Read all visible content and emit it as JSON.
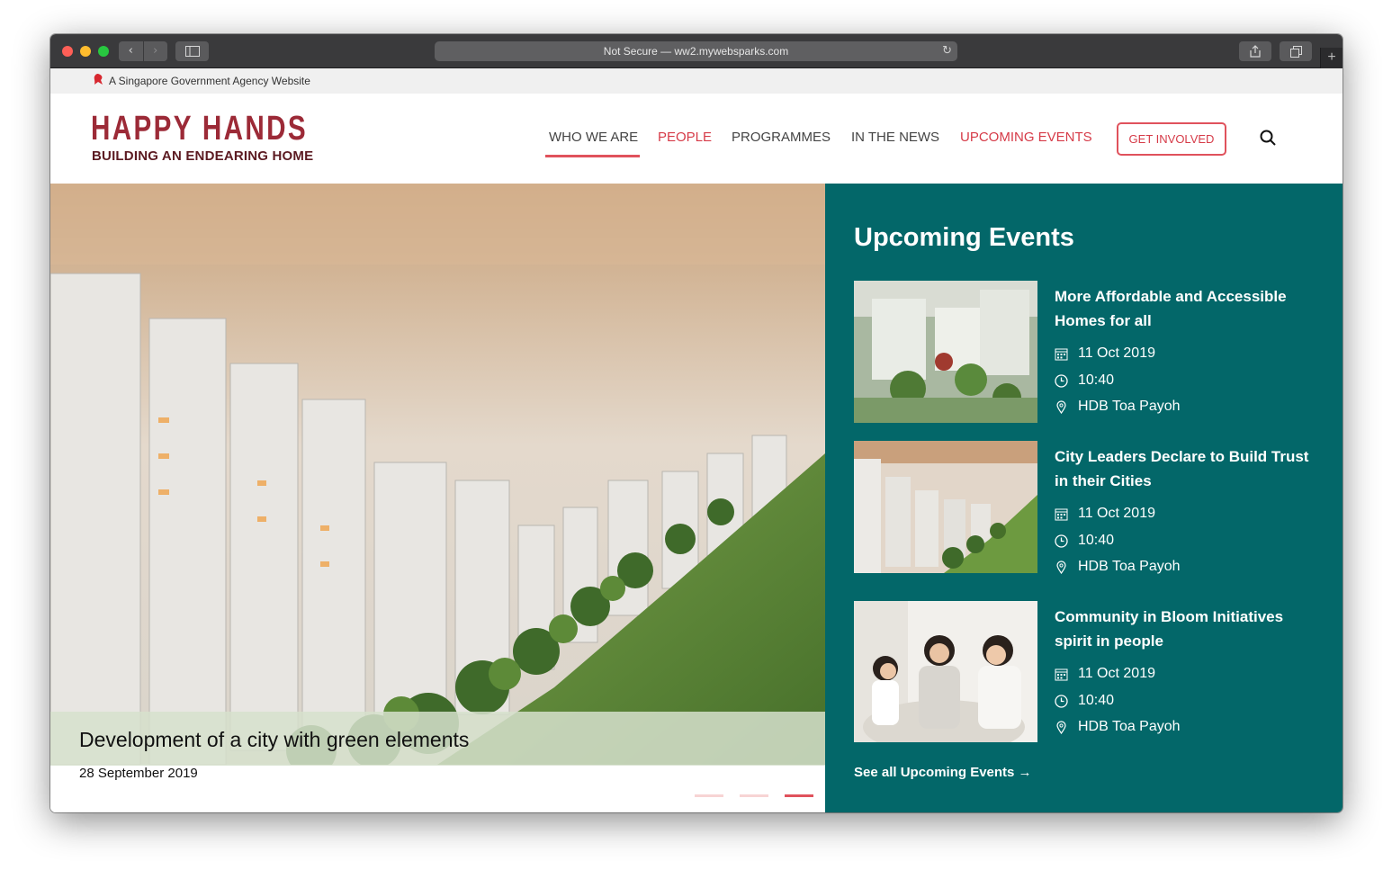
{
  "browser": {
    "url_text": "Not Secure — ww2.mywebsparks.com",
    "back": "‹",
    "forward": "›",
    "reload": "↻",
    "new_tab": "+"
  },
  "gov_banner": {
    "text": "A Singapore Government Agency Website"
  },
  "logo": {
    "main": "HAPPY HANDS",
    "sub": "BUILDING AN ENDEARING HOME"
  },
  "nav": {
    "items": [
      {
        "label": "WHO WE ARE"
      },
      {
        "label": "PEOPLE"
      },
      {
        "label": "PROGRAMMES"
      },
      {
        "label": "IN THE NEWS"
      },
      {
        "label": "UPCOMING EVENTS"
      }
    ],
    "cta": "GET INVOLVED"
  },
  "hero": {
    "title": "Development of a city with green elements",
    "date": "28 September 2019",
    "slide_count": 3,
    "active_slide": 3
  },
  "events": {
    "heading": "Upcoming Events",
    "items": [
      {
        "title": "More Affordable and Accessible Homes for all",
        "date": "11 Oct 2019",
        "time": "10:40",
        "location": "HDB Toa Payoh"
      },
      {
        "title": "City Leaders Declare to Build Trust in their Cities",
        "date": "11 Oct 2019",
        "time": "10:40",
        "location": "HDB Toa Payoh"
      },
      {
        "title": "Community in Bloom Initiatives spirit in people",
        "date": "11 Oct 2019",
        "time": "10:40",
        "location": "HDB Toa Payoh"
      }
    ],
    "see_all": "See all Upcoming Events →"
  },
  "colors": {
    "brand_red": "#9c2a37",
    "accent_red": "#e0525c",
    "teal": "#036769"
  }
}
